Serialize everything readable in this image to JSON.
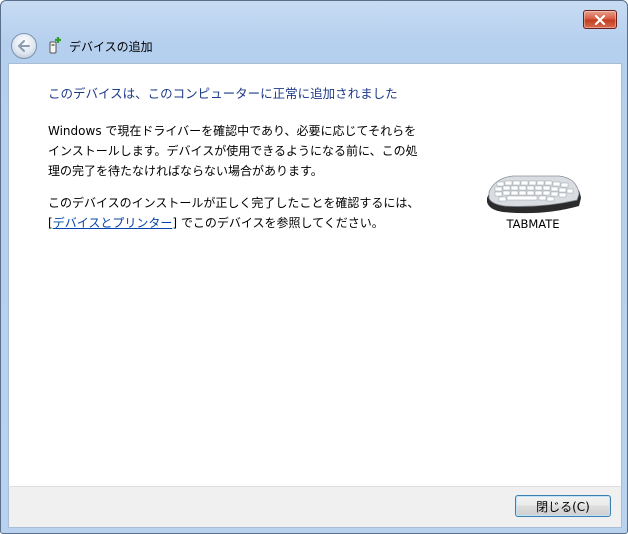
{
  "window": {
    "title_bar_buttons": [
      "close-icon"
    ]
  },
  "nav": {
    "title": "デバイスの追加"
  },
  "content": {
    "heading": "このデバイスは、このコンピューターに正常に追加されました",
    "paragraph1": "Windows で現在ドライバーを確認中であり、必要に応じてそれらをインストールします。デバイスが使用できるようになる前に、この処理の完了を待たなければならない場合があります。",
    "paragraph2_before": "このデバイスのインストールが正しく完了したことを確認するには、[",
    "paragraph2_link": "デバイスとプリンター",
    "paragraph2_after": "] でこのデバイスを参照してください。",
    "device": {
      "name": "TABMATE",
      "icon": "keyboard-icon"
    }
  },
  "footer": {
    "close_label": "閉じる(C)"
  },
  "colors": {
    "heading": "#1e3a8a",
    "link": "#0645ad",
    "close_red": "#c23a1f"
  }
}
